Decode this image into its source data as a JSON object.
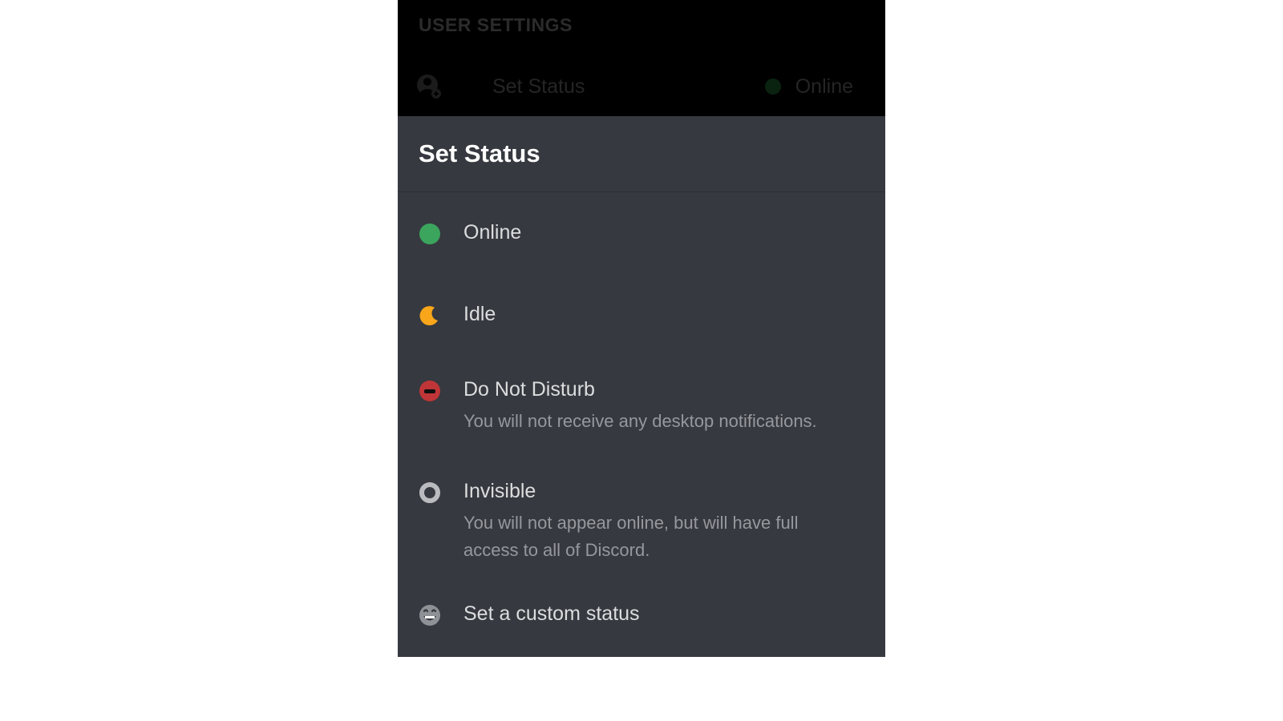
{
  "header": {
    "title": "USER SETTINGS",
    "set_status_label": "Set Status",
    "current_status_label": "Online"
  },
  "sheet": {
    "title": "Set Status"
  },
  "statuses": {
    "online": {
      "label": "Online"
    },
    "idle": {
      "label": "Idle"
    },
    "dnd": {
      "label": "Do Not Disturb",
      "description": "You will not receive any desktop notifications."
    },
    "invisible": {
      "label": "Invisible",
      "description": "You will not appear online, but will have full access to all of Discord."
    },
    "custom": {
      "label": "Set a custom status"
    }
  }
}
